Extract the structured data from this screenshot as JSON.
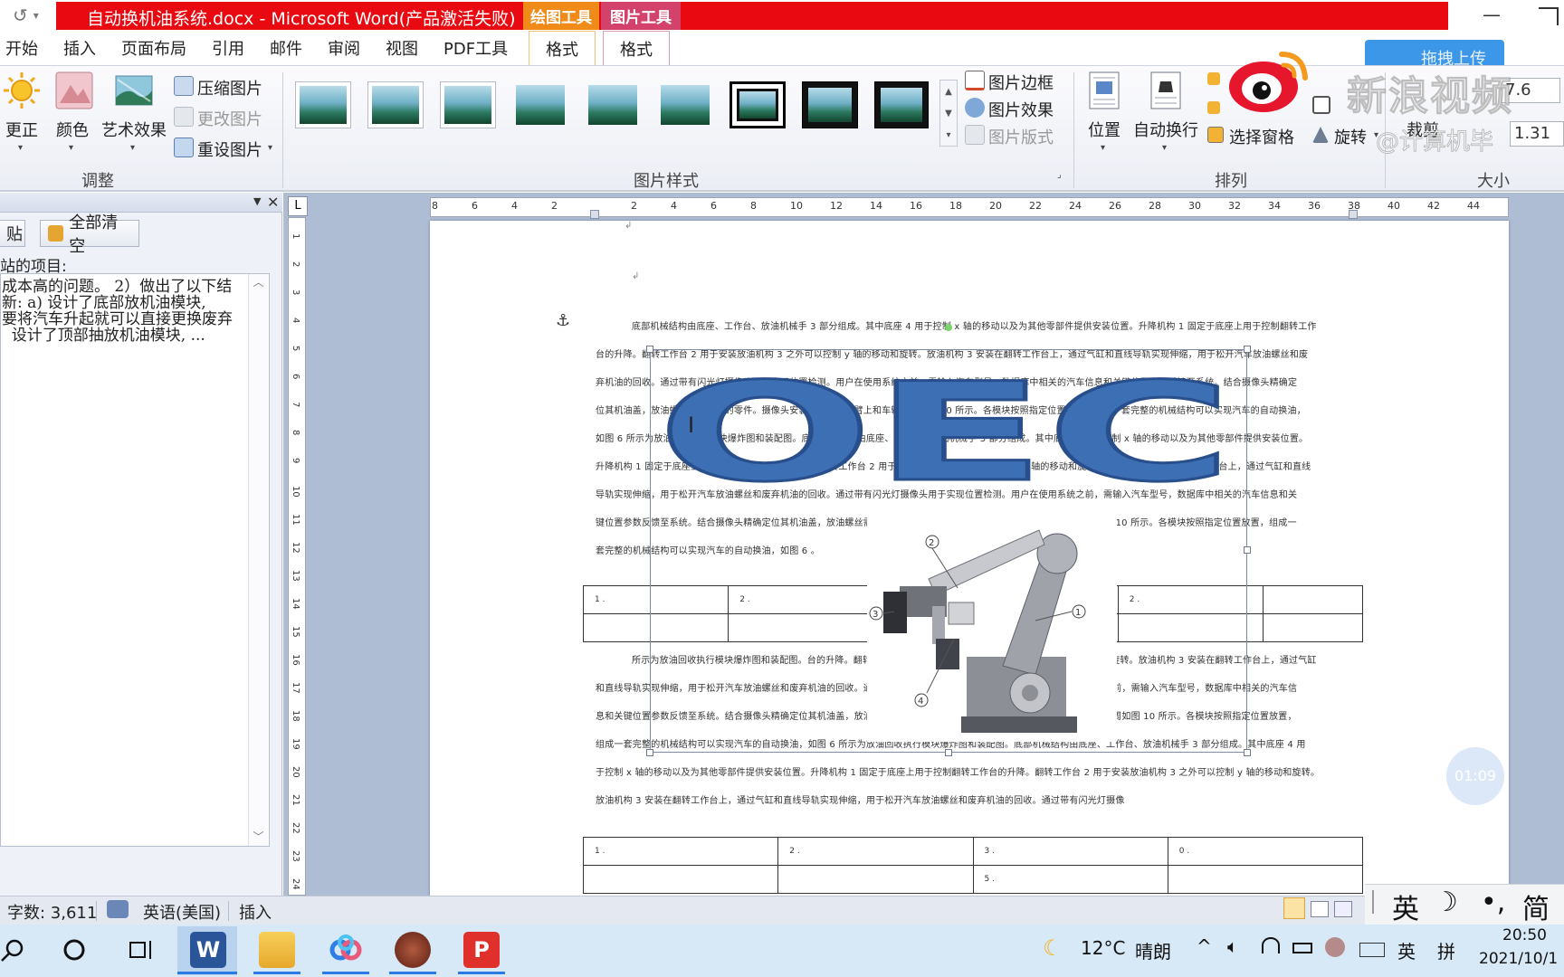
{
  "window": {
    "title": "自动换机油系统.docx - Microsoft Word(产品激活失败)",
    "context_tab_drawing": "绘图工具",
    "context_tab_picture": "图片工具",
    "minimize": "—"
  },
  "menu": {
    "tabs": [
      "开始",
      "插入",
      "页面布局",
      "引用",
      "邮件",
      "审阅",
      "视图",
      "PDF工具"
    ],
    "format_drawing": "格式",
    "format_picture": "格式"
  },
  "ribbon": {
    "adjust": {
      "corrections": "更正",
      "color": "颜色",
      "artistic": "艺术效果",
      "compress": "压缩图片",
      "change": "更改图片",
      "reset": "重设图片",
      "group_label": "调整"
    },
    "styles": {
      "border": "图片边框",
      "effects": "图片效果",
      "layout": "图片版式",
      "group_label": "图片样式"
    },
    "arrange": {
      "position": "位置",
      "wrap": "自动换行",
      "selection_pane": "选择窗格",
      "rotate": "旋转",
      "group_label": "排列"
    },
    "size": {
      "crop": "裁剪",
      "height": "7.6",
      "width": "1.31",
      "group_label": "大小"
    },
    "upload_btn": "拖拽上传"
  },
  "clipboard_pane": {
    "paste_btn": "贴",
    "clear_all_btn": "全部清空",
    "label": "站的项目:",
    "item_text": "成本高的问题。 2）做出了以下结\n新: a) 设计了底部放机油模块,\n要将汽车升起就可以直接更换废弃\n  设计了顶部抽放机油模块, ..."
  },
  "ruler": {
    "corner": "L",
    "h_ticks": [
      "8",
      "6",
      "4",
      "2",
      "",
      "2",
      "4",
      "6",
      "8",
      "10",
      "12",
      "14",
      "16",
      "18",
      "20",
      "22",
      "24",
      "26",
      "28",
      "30",
      "32",
      "34",
      "36",
      "38",
      "40",
      "42",
      "44"
    ],
    "v_ticks": [
      "1",
      "2",
      "3",
      "4",
      "5",
      "6",
      "7",
      "8",
      "9",
      "10",
      "11",
      "12",
      "13",
      "14",
      "15",
      "16",
      "17",
      "18",
      "19",
      "20",
      "21",
      "22",
      "23",
      "24"
    ]
  },
  "document": {
    "lines_top": [
      "底部机械结构由底座、工作台、放油机械手 3 部分组成。其中底座 4 用于控制 x 轴的移动以及为其他零部件提供安装位置。升降机构 1 固定于底座上用于控制翻转工作",
      "台的升降。翻转工作台 2 用于安装放油机构 3 之外可以控制 y 轴的移动和旋转。放油机构 3 安装在翻转工作台上，通过气缸和直线导轨实现伸缩，用于松开汽车放油螺丝和废",
      "弃机油的回收。通过带有闪光灯摄像头用于实现位置检测。用户在使用系统之前，需输入汽车型号，数据库中相关的汽车信息和关键位置参数反馈至系统。结合摄像头精确定",
      "位其机油盖，放油螺丝需要更换的零件。摄像头安装位置在机械臂上和车辆四周如图 10 所示。各模块按照指定位置放置，组成一套完整的机械结构可以实现汽车的自动换油，",
      "如图 6 所示为放油回收执行模块爆炸图和装配图。底部机械结构由底座、工作台、放油机械手 3 部分组成。其中底座 4 用于控制 x 轴的移动以及为其他零部件提供安装位置。",
      "升降机构 1 固定于底座上用于控制翻转工作台的升降。翻转工作台 2 用于安装放油机构 3 之外可以控制 y 轴的移动和旋转。放油机构 3 安装在翻转工作台上，通过气缸和直线",
      "导轨实现伸缩，用于松开汽车放油螺丝和废弃机油的回收。通过带有闪光灯摄像头用于实现位置检测。用户在使用系统之前，需输入汽车型号，数据库中相关的汽车信息和关",
      "键位置参数反馈至系统。结合摄像头精确定位其机油盖，放油螺丝需要更换的零件。摄像头安装位置在机械臂上和车辆四周如图 10 所示。各模块按照指定位置放置，组成一",
      "套完整的机械结构可以实现汽车的自动换油，如图 6 。"
    ],
    "table1": [
      [
        "1 .",
        "2 .",
        "3 .",
        "",
        "2 .",
        ""
      ],
      [
        "",
        "",
        " ",
        "",
        "",
        ""
      ]
    ],
    "lines_mid": [
      "所示为放油回收执行模块爆炸图和装配图。台的升降。翻转工作台 2 用于安装放油机构 3 之外可以控制 y 轴的移动和旋转。放油机构 3 安装在翻转工作台上，通过气缸",
      "和直线导轨实现伸缩，用于松开汽车放油螺丝和废弃机油的回收。通过带有闪光灯摄像头用于实现位置检测。用户在使用系统之前，需输入汽车型号，数据库中相关的汽车信",
      "息和关键位置参数反馈至系统。结合摄像头精确定位其机油盖，放油螺丝需要更换的零件。摄像头安装位置在机械臂上和车辆四周如图 10 所示。各模块按照指定位置放置，",
      "组成一套完整的机械结构可以实现汽车的自动换油，如图 6 所示为放油回收执行模块爆炸图和装配图。底部机械结构由底座、工作台、放油机械手 3 部分组成。其中底座 4 用",
      "于控制 x 轴的移动以及为其他零部件提供安装位置。升降机构 1 固定于底座上用于控制翻转工作台的升降。翻转工作台 2 用于安装放油机构 3 之外可以控制 y 轴的移动和旋转。",
      "放油机构 3 安装在翻转工作台上，通过气缸和直线导轨实现伸缩，用于松开汽车放油螺丝和废弃机油的回收。通过带有闪光灯摄像"
    ],
    "table2": [
      [
        "1 .",
        "2 .",
        "3 .",
        "0 ."
      ],
      [
        "",
        "",
        "5 .",
        ""
      ]
    ],
    "wordart": "OEC",
    "callouts": [
      "2",
      "3",
      "1",
      "4"
    ],
    "timer": "01:09"
  },
  "statusbar": {
    "word_count": "字数: 3,611",
    "language": "英语(美国)",
    "mode": "插入"
  },
  "ime": {
    "lang": "英",
    "moon": "☽",
    "punct": "•,",
    "simplified": "简"
  },
  "taskbar": {
    "weather_temp": "12°C",
    "weather_desc": "晴朗",
    "ime_lang": "英",
    "ime_mode": "拼",
    "time": "20:50",
    "date": "2021/10/1"
  },
  "watermark": {
    "text": "新浪视频",
    "handle": "@计算机毕"
  },
  "colors": {
    "title_red": "#e80a10",
    "ctx_draw": "#f08a19",
    "ctx_pic": "#d3426b",
    "wordart_blue": "#3d6fb5"
  }
}
